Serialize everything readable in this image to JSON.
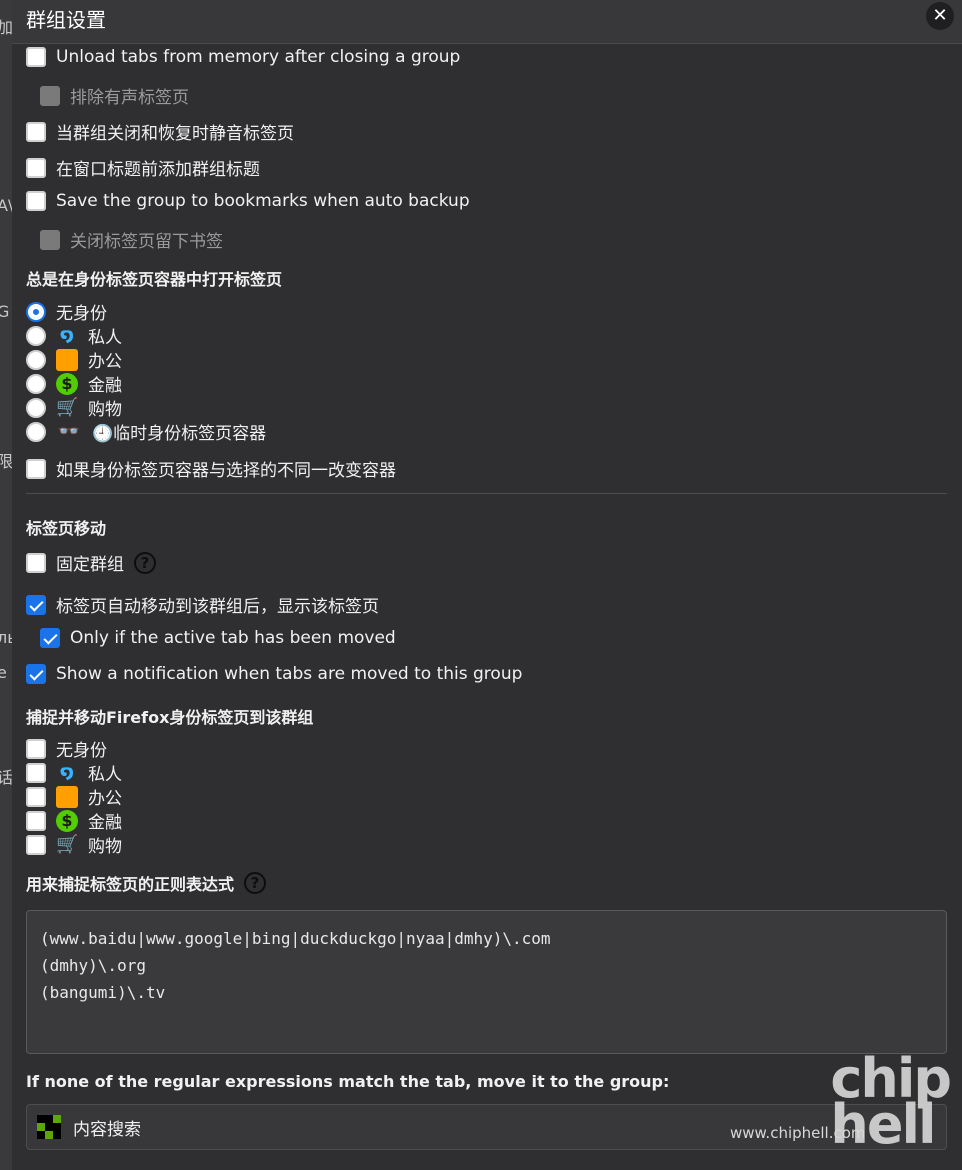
{
  "dialog": {
    "title": "群组设置",
    "close_label": "✕"
  },
  "background_fragments": [
    "加",
    "G",
    "A\\",
    "G",
    "限",
    "ль",
    "e",
    "话"
  ],
  "options": {
    "unload_tabs": "Unload tabs from memory after closing a group",
    "exclude_audible": "排除有声标签页",
    "mute_tabs": "当群组关闭和恢复时静音标签页",
    "prefix_title": "在窗口标题前添加群组标题",
    "save_bookmarks": "Save the group to bookmarks when auto backup",
    "keep_bookmark": "关闭标签页留下书签"
  },
  "container_section": {
    "title": "总是在身份标签页容器中打开标签页",
    "items": [
      {
        "label": "无身份",
        "selected": true,
        "icon": "none"
      },
      {
        "label": "私人",
        "selected": false,
        "icon": "fingerprint-icon"
      },
      {
        "label": "办公",
        "selected": false,
        "icon": "briefcase-icon"
      },
      {
        "label": "金融",
        "selected": false,
        "icon": "dollar-icon"
      },
      {
        "label": "购物",
        "selected": false,
        "icon": "cart-icon"
      },
      {
        "label": "🕘临时身份标签页容器",
        "selected": false,
        "icon": "glasses-icon"
      }
    ],
    "change_container": "如果身份标签页容器与选择的不同一改变容器"
  },
  "move_section": {
    "title": "标签页移动",
    "pin_group": "固定群组",
    "auto_show": "标签页自动移动到该群组后，显示该标签页",
    "only_active": "Only if the active tab has been moved",
    "notify": "Show a notification when tabs are moved to this group"
  },
  "catch_section": {
    "title": "捕捉并移动Firefox身份标签页到该群组",
    "items": [
      {
        "label": "无身份",
        "icon": "none"
      },
      {
        "label": "私人",
        "icon": "fingerprint-icon"
      },
      {
        "label": "办公",
        "icon": "briefcase-icon"
      },
      {
        "label": "金融",
        "icon": "dollar-icon"
      },
      {
        "label": "购物",
        "icon": "cart-icon"
      }
    ]
  },
  "regex_section": {
    "title": "用来捕捉标签页的正则表达式",
    "value": "(www.baidu|www.google|bing|duckduckgo|nyaa|dmhy)\\.com\n(dmhy)\\.org\n(bangumi)\\.tv"
  },
  "fallback_section": {
    "title": "If none of the regular expressions match the tab, move it to the group:",
    "selected_group": "内容搜索"
  },
  "watermark": {
    "url": "www.chiphell.com",
    "logo": "chip hell"
  },
  "help_label": "?",
  "colors": {
    "accent": "#1a73e8",
    "background": "#2f2f32",
    "fingerprint": "#37b3ff",
    "briefcase": "#ff9f00",
    "dollar": "#51cd00",
    "cart": "#ff4bda"
  }
}
